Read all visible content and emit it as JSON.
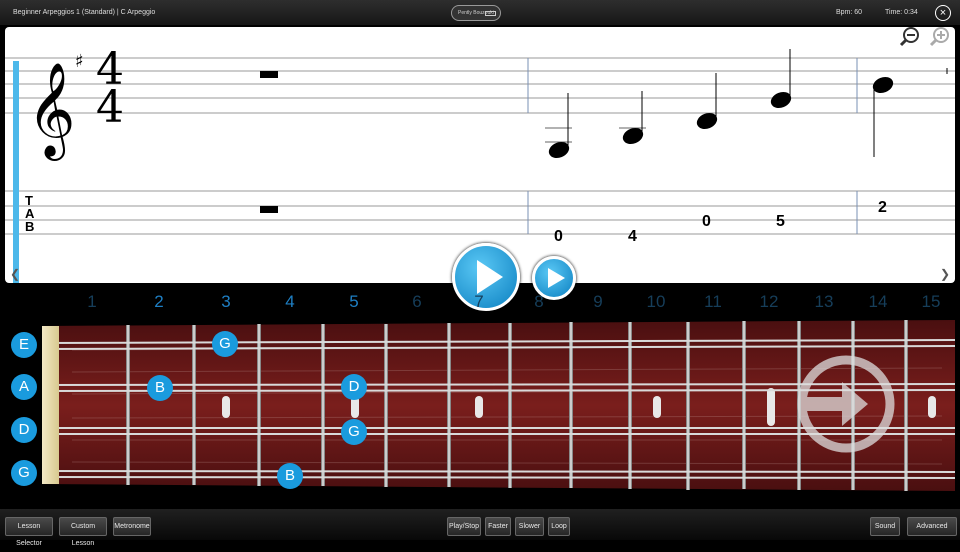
{
  "header": {
    "lesson_title": "Beginner Arpeggios 1 (Standard)  |  C Arpeggio",
    "logo_text": "Pently Bouzouki",
    "bpm": "Bpm: 60",
    "time": "Time: 0:34",
    "close_icon": "close-icon"
  },
  "notation": {
    "time_sig_top": "4",
    "time_sig_bottom": "4",
    "key_signature": "sharp",
    "tab_label": [
      "T",
      "A",
      "B"
    ],
    "tab_numbers": [
      "0",
      "4",
      "0",
      "5",
      "2"
    ]
  },
  "fretboard": {
    "fret_numbers": [
      "1",
      "2",
      "3",
      "4",
      "5",
      "6",
      "7",
      "8",
      "9",
      "10",
      "11",
      "12",
      "13",
      "14",
      "15"
    ],
    "string_labels": [
      "E",
      "A",
      "D",
      "G"
    ],
    "notes": [
      {
        "label": "G",
        "string": 0,
        "fret": 3
      },
      {
        "label": "B",
        "string": 1,
        "fret": 2
      },
      {
        "label": "D",
        "string": 1,
        "fret": 5
      },
      {
        "label": "G",
        "string": 2,
        "fret": 5
      },
      {
        "label": "B",
        "string": 3,
        "fret": 4
      }
    ],
    "next_icon": "arrow-right-circle-icon"
  },
  "toolbar": {
    "lesson_selector": "Lesson Selector",
    "custom_lesson": "Custom Lesson",
    "metronome": "Metronome",
    "play_stop": "Play/Stop",
    "faster": "Faster",
    "slower": "Slower",
    "loop": "Loop",
    "sound": "Sound",
    "advanced": "Advanced"
  }
}
